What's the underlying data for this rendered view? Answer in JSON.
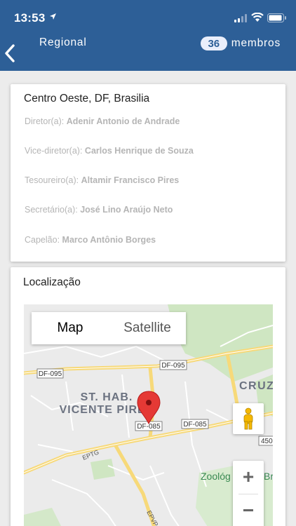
{
  "status_bar": {
    "time": "13:53"
  },
  "nav": {
    "title": "Regional",
    "members_count": "36",
    "members_label": "membros"
  },
  "info": {
    "location": "Centro Oeste, DF, Brasilia",
    "roles": [
      {
        "label": "Diretor(a):",
        "name": "Adenir Antonio de Andrade"
      },
      {
        "label": "Vice-diretor(a):",
        "name": "Carlos Henrique de Souza"
      },
      {
        "label": "Tesoureiro(a):",
        "name": "Altamir Francisco Pires"
      },
      {
        "label": "Secretário(a):",
        "name": "José Lino Araújo Neto"
      },
      {
        "label": "Capelão:",
        "name": "Marco Antônio Borges"
      }
    ]
  },
  "location_card": {
    "title": "Localização",
    "map": {
      "type_options": [
        "Map",
        "Satellite"
      ],
      "selected_type": "Map",
      "place_label_line1": "ST. HAB.",
      "place_label_line2": "VICENTE PIRES",
      "area_label": "CRUZ",
      "poi_label": "Zoológ",
      "poi_label_2": "Br",
      "road_shields": [
        "DF-095",
        "DF-095",
        "DF-085",
        "DF-085",
        "450"
      ],
      "road_names": [
        "EPTG",
        "EPVP"
      ],
      "zoom_in_label": "+",
      "zoom_out_label": "−"
    }
  },
  "colors": {
    "header": "#2d5f97",
    "badge_bg": "#e9eefb",
    "marker": "#e53935",
    "road_yellow": "#f7d979",
    "park_green": "#cfe6c2"
  }
}
